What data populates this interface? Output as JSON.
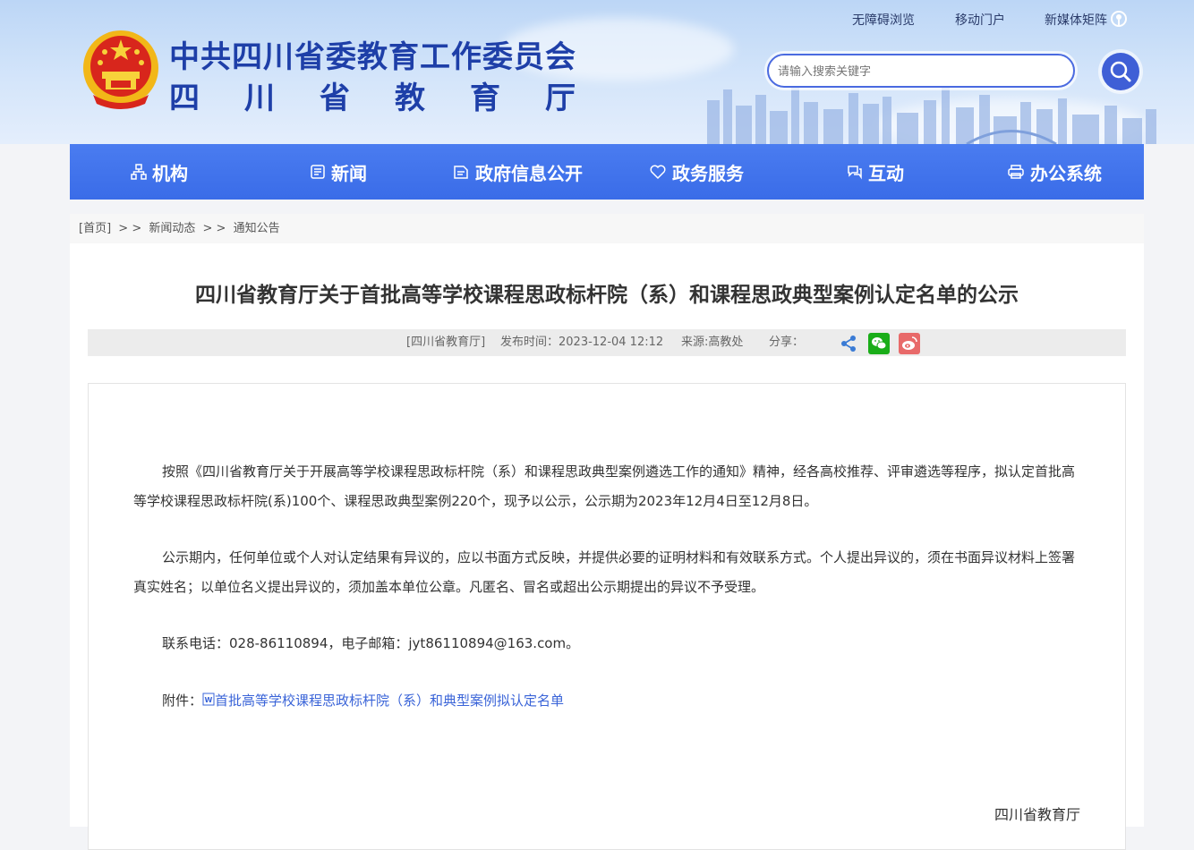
{
  "header": {
    "title_line1": "中共四川省委教育工作委员会",
    "title_line2": "四川省教育厅",
    "top_links": [
      "无障碍浏览",
      "移动门户",
      "新媒体矩阵"
    ],
    "search_placeholder": "请输入搜索关键字"
  },
  "nav": {
    "items": [
      {
        "label": "机构",
        "icon": "org-chart-icon"
      },
      {
        "label": "新闻",
        "icon": "newspaper-icon"
      },
      {
        "label": "政府信息公开",
        "icon": "document-icon"
      },
      {
        "label": "政务服务",
        "icon": "heart-hand-icon"
      },
      {
        "label": "互动",
        "icon": "chat-icon"
      },
      {
        "label": "办公系统",
        "icon": "printer-icon"
      }
    ]
  },
  "breadcrumb": {
    "home": "[首页]",
    "sep1": "> >",
    "level1": "新闻动态",
    "sep2": "> >",
    "level2": "通知公告"
  },
  "article": {
    "title": "四川省教育厅关于首批高等学校课程思政标杆院（系）和课程思政典型案例认定名单的公示",
    "meta": {
      "org": "[四川省教育厅]",
      "publish": "发布时间：2023-12-04 12:12",
      "source": "来源:高教处",
      "share_label": "分享："
    },
    "paragraphs": [
      "按照《四川省教育厅关于开展高等学校课程思政标杆院（系）和课程思政典型案例遴选工作的通知》精神，经各高校推荐、评审遴选等程序，拟认定首批高等学校课程思政标杆院(系)100个、课程思政典型案例220个，现予以公示，公示期为2023年12月4日至12月8日。",
      "公示期内，任何单位或个人对认定结果有异议的，应以书面方式反映，并提供必要的证明材料和有效联系方式。个人提出异议的，须在书面异议材料上签署真实姓名；以单位名义提出异议的，须加盖本单位公章。凡匿名、冒名或超出公示期提出的异议不予受理。",
      "联系电话：028-86110894，电子邮箱：jyt86110894@163.com。"
    ],
    "attachment_label": "附件：",
    "attachment_link": "首批高等学校课程思政标杆院（系）和典型案例拟认定名单",
    "signature": "四川省教育厅"
  },
  "colors": {
    "nav_blue": "#3f70ec",
    "title_blue": "#1e3fa8",
    "link_blue": "#3a64d8",
    "wechat_green": "#1aad19",
    "weibo_red": "#e86a6a"
  }
}
